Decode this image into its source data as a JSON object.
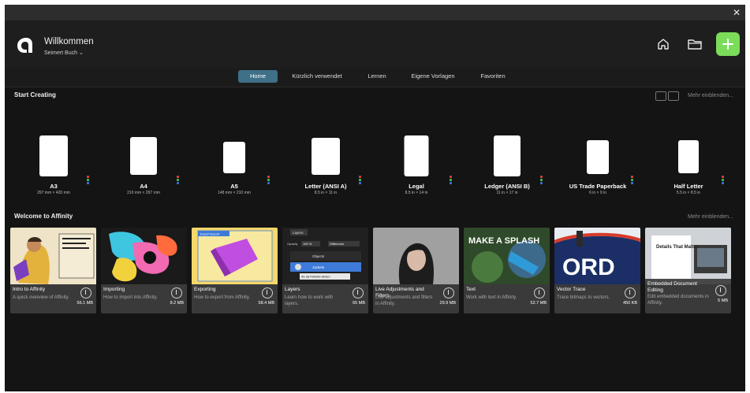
{
  "window": {
    "close_icon": "close-icon"
  },
  "header": {
    "title": "Willkommen",
    "user": "Seimert Buch ⌄",
    "icons": [
      "affinity-logo-icon",
      "home-icon",
      "folder-icon",
      "plus-icon"
    ],
    "accent": "#7bdc5a"
  },
  "tabs": [
    {
      "label": "Home",
      "active": true
    },
    {
      "label": "Kürzlich verwendet",
      "active": false
    },
    {
      "label": "Lernen",
      "active": false
    },
    {
      "label": "Eigene Vorlagen",
      "active": false
    },
    {
      "label": "Favoriten",
      "active": false
    }
  ],
  "tab_active_color": "#3e7088",
  "start": {
    "title": "Start Creating",
    "more": "Mehr einblenden...",
    "presets": [
      {
        "name": "A3",
        "dim": "297 mm × 420 mm"
      },
      {
        "name": "A4",
        "dim": "210 mm × 297 mm"
      },
      {
        "name": "A5",
        "dim": "148 mm × 210 mm"
      },
      {
        "name": "Letter (ANSI A)",
        "dim": "8.5 in × 11 in"
      },
      {
        "name": "Legal",
        "dim": "8.5 in × 14 in"
      },
      {
        "name": "Ledger (ANSI B)",
        "dim": "11 in × 17 in"
      },
      {
        "name": "US Trade Paperback",
        "dim": "6 in × 9 in"
      },
      {
        "name": "Half Letter",
        "dim": "5.5 in × 8.5 in"
      }
    ]
  },
  "learn": {
    "title": "Welcome to Affinity",
    "more": "Mehr einblenden...",
    "cards": [
      {
        "title": "Intro to Affinity",
        "desc": "A quick overview of Affinity.",
        "size": "56.1 MB"
      },
      {
        "title": "Importing",
        "desc": "How to import into Affinity.",
        "size": "8.2 MB"
      },
      {
        "title": "Exporting",
        "desc": "How to export from Affinity.",
        "size": "58.4 MB"
      },
      {
        "title": "Layers",
        "desc": "Learn how to work with layers.",
        "size": "65 MB"
      },
      {
        "title": "Live Adjustments and Filters",
        "desc": "Use adjustments and filters in Affinity.",
        "size": "29.9 MB"
      },
      {
        "title": "Text",
        "desc": "Work with text in Affinity.",
        "size": "52.7 MB"
      },
      {
        "title": "Vector Trace",
        "desc": "Trace bitmaps to vectors.",
        "size": "450 KB"
      },
      {
        "title": "Embedded Document Editing",
        "desc": "Edit embedded documents in Affinity.",
        "size": "5 MB"
      }
    ],
    "thumb_text": {
      "exporting": "Export Export",
      "layers_panel": "Layers",
      "opacity": "Opacity",
      "opacity_value": "100 %",
      "blend": "Difference",
      "layer1": "Objects",
      "layer2": "Jackets",
      "tooltip": "Als als Füllfarbe klicken",
      "text_art": "MAKE A SPLASH",
      "vector_art": "ORD",
      "embed_art": "Details That Matter"
    }
  }
}
